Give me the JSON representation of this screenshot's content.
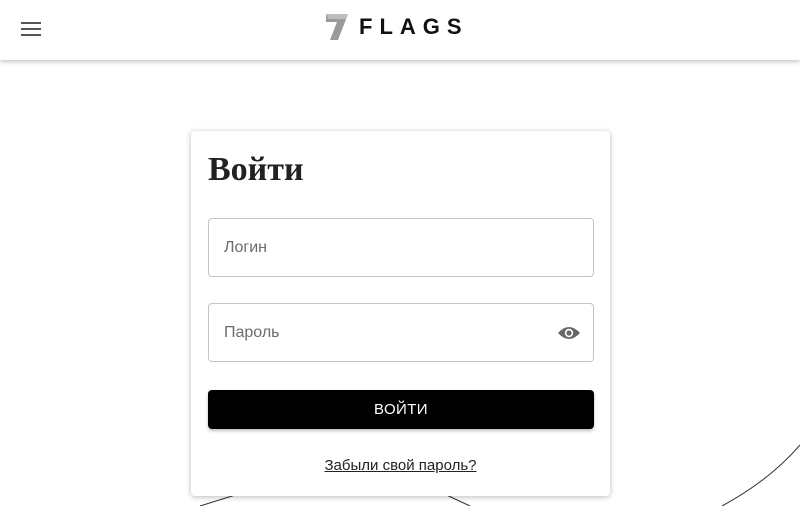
{
  "header": {
    "brand": "FLAGS",
    "menu_icon": "hamburger-menu-icon",
    "logo_icon": "seven-logo-icon"
  },
  "login_form": {
    "title": "Войти",
    "login_placeholder": "Логин",
    "password_placeholder": "Пароль",
    "password_toggle_icon": "eye-icon",
    "submit_label": "ВОЙТИ",
    "forgot_password_label": "Забыли свой пароль?"
  },
  "colors": {
    "button_bg": "#000000",
    "button_text": "#ffffff",
    "text": "#222222",
    "field_border": "#c4c4c4"
  }
}
